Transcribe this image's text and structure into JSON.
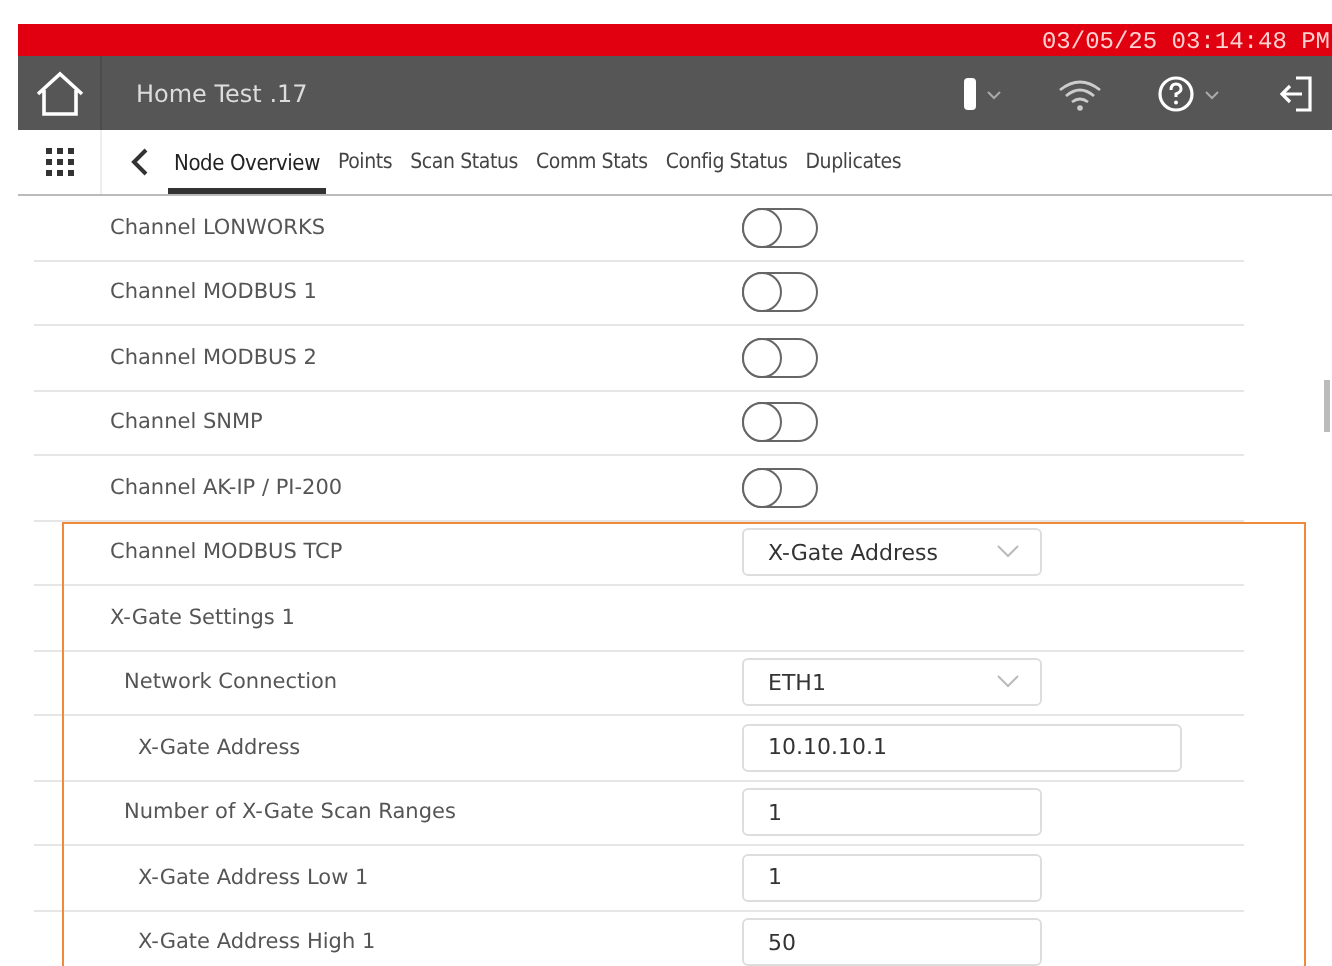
{
  "status_bar": {
    "datetime": "03/05/25 03:14:48 PM"
  },
  "header": {
    "title": "Home Test .17"
  },
  "tabs": [
    {
      "label": "Node Overview",
      "selected": true
    },
    {
      "label": "Points",
      "selected": false
    },
    {
      "label": "Scan Status",
      "selected": false
    },
    {
      "label": "Comm Stats",
      "selected": false
    },
    {
      "label": "Config Status",
      "selected": false
    },
    {
      "label": "Duplicates",
      "selected": false
    }
  ],
  "rows": [
    {
      "kind": "toggle",
      "label": "Channel LONWORKS",
      "on": false
    },
    {
      "kind": "toggle",
      "label": "Channel MODBUS 1",
      "on": false
    },
    {
      "kind": "toggle",
      "label": "Channel MODBUS 2",
      "on": false
    },
    {
      "kind": "toggle",
      "label": "Channel SNMP",
      "on": false
    },
    {
      "kind": "toggle",
      "label": "Channel AK-IP / PI-200",
      "on": false
    }
  ],
  "highlighted_rows": [
    {
      "kind": "select",
      "label": "Channel MODBUS TCP",
      "value": "X-Gate Address"
    },
    {
      "kind": "heading",
      "label": "X-Gate Settings 1",
      "children": [
        {
          "kind": "select",
          "label": "Network Connection",
          "value": "ETH1",
          "children": [
            {
              "kind": "text",
              "label": "X-Gate Address",
              "value": "10.10.10.1",
              "wide": true
            }
          ]
        },
        {
          "kind": "text",
          "label": "Number of X-Gate Scan Ranges",
          "value": "1",
          "children": [
            {
              "kind": "text",
              "label": "X-Gate Address Low 1",
              "value": "1"
            },
            {
              "kind": "text",
              "label": "X-Gate Address High 1",
              "value": "50"
            }
          ]
        }
      ]
    }
  ]
}
